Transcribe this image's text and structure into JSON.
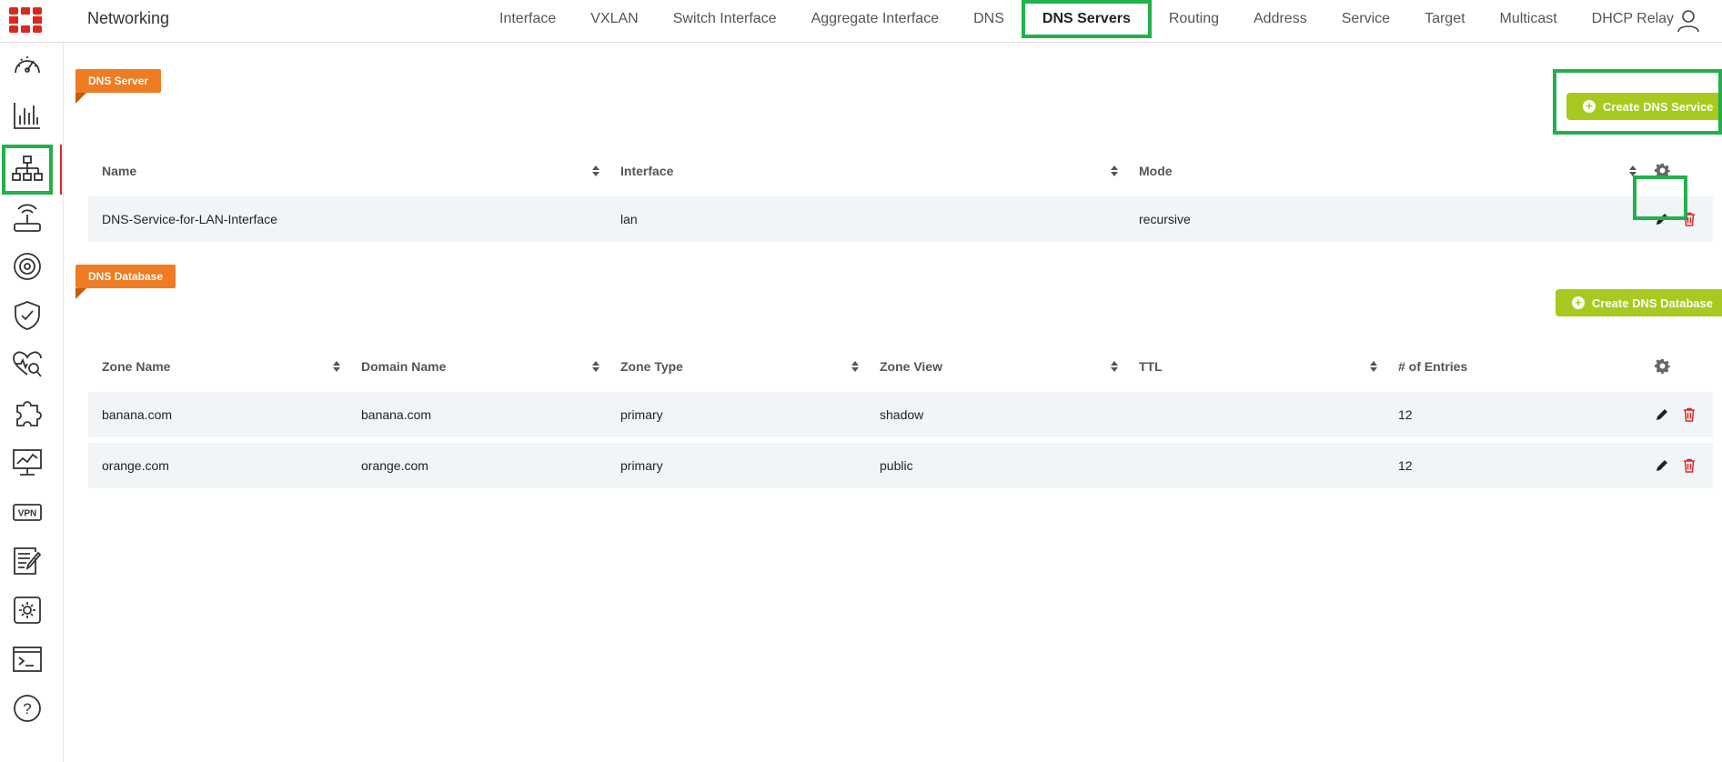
{
  "app": {
    "title": "Networking"
  },
  "nav": {
    "tabs": [
      {
        "label": "Interface"
      },
      {
        "label": "VXLAN"
      },
      {
        "label": "Switch Interface"
      },
      {
        "label": "Aggregate Interface"
      },
      {
        "label": "DNS"
      },
      {
        "label": "DNS Servers",
        "active": true
      },
      {
        "label": "Routing"
      },
      {
        "label": "Address"
      },
      {
        "label": "Service"
      },
      {
        "label": "Target"
      },
      {
        "label": "Multicast"
      },
      {
        "label": "DHCP Relay"
      }
    ]
  },
  "sidebar": {
    "items": [
      {
        "icon": "dashboard-gauge-icon"
      },
      {
        "icon": "bar-chart-icon"
      },
      {
        "icon": "network-topology-icon",
        "active": true
      },
      {
        "icon": "wireless-router-icon"
      },
      {
        "icon": "signal-broadcast-icon"
      },
      {
        "icon": "shield-check-icon"
      },
      {
        "icon": "health-heart-search-icon"
      },
      {
        "icon": "puzzle-icon"
      },
      {
        "icon": "monitor-chart-icon"
      },
      {
        "icon": "vpn-icon",
        "text": "VPN"
      },
      {
        "icon": "log-edit-icon"
      },
      {
        "icon": "settings-gear-icon"
      },
      {
        "icon": "terminal-icon"
      },
      {
        "icon": "help-icon",
        "text": "?"
      }
    ]
  },
  "dns_server": {
    "tag": "DNS Server",
    "create_label": "Create DNS Service",
    "columns": [
      "Name",
      "Interface",
      "Mode"
    ],
    "rows": [
      {
        "name": "DNS-Service-for-LAN-Interface",
        "interface": "lan",
        "mode": "recursive"
      }
    ]
  },
  "dns_database": {
    "tag": "DNS Database",
    "create_label": "Create DNS Database",
    "columns": [
      "Zone Name",
      "Domain Name",
      "Zone Type",
      "Zone View",
      "TTL",
      "# of Entries"
    ],
    "rows": [
      {
        "zone_name": "banana.com",
        "domain_name": "banana.com",
        "zone_type": "primary",
        "zone_view": "shadow",
        "ttl": "",
        "entries": "12"
      },
      {
        "zone_name": "orange.com",
        "domain_name": "orange.com",
        "zone_type": "primary",
        "zone_view": "public",
        "ttl": "",
        "entries": "12"
      }
    ]
  },
  "colors": {
    "accent_orange": "#ef7b22",
    "button_green": "#a8c91f",
    "highlight_green": "#22b14c",
    "delete_red": "#e0262b",
    "row_bg": "#f1f5f8"
  }
}
